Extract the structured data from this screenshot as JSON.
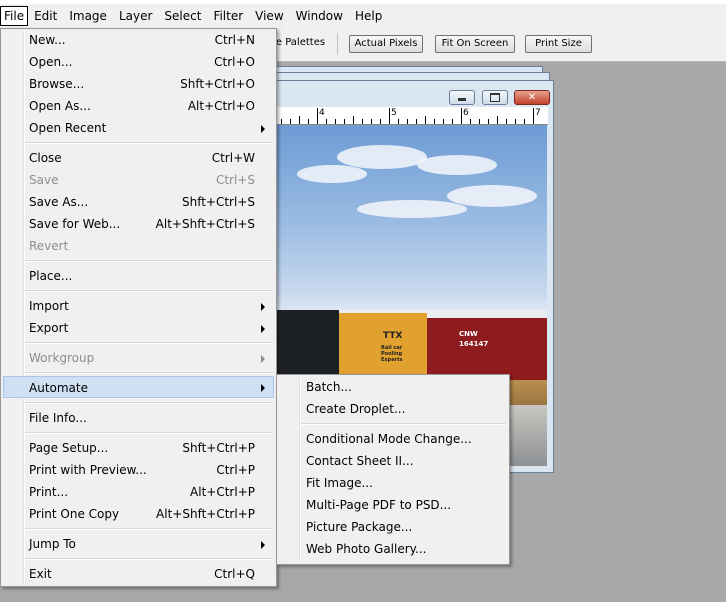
{
  "menubar": {
    "items": [
      "File",
      "Edit",
      "Image",
      "Layer",
      "Select",
      "Filter",
      "View",
      "Window",
      "Help"
    ]
  },
  "options_bar": {
    "partial_label": "re Palettes",
    "buttons": [
      "Actual Pixels",
      "Fit On Screen",
      "Print Size"
    ]
  },
  "document": {
    "ruler_numbers": [
      "4",
      "5",
      "6",
      "7"
    ],
    "car_logo": "TTX",
    "car_text_yellow": "Rail car Pooling Experts",
    "car_text_red_1": "CNW",
    "car_text_red_2": "164147"
  },
  "file_menu": {
    "items": [
      {
        "label": "New...",
        "shortcut": "Ctrl+N"
      },
      {
        "label": "Open...",
        "shortcut": "Ctrl+O"
      },
      {
        "label": "Browse...",
        "shortcut": "Shft+Ctrl+O"
      },
      {
        "label": "Open As...",
        "shortcut": "Alt+Ctrl+O"
      },
      {
        "label": "Open Recent",
        "shortcut": ""
      },
      {
        "label": "Close",
        "shortcut": "Ctrl+W"
      },
      {
        "label": "Save",
        "shortcut": "Ctrl+S"
      },
      {
        "label": "Save As...",
        "shortcut": "Shft+Ctrl+S"
      },
      {
        "label": "Save for Web...",
        "shortcut": "Alt+Shft+Ctrl+S"
      },
      {
        "label": "Revert",
        "shortcut": ""
      },
      {
        "label": "Place...",
        "shortcut": ""
      },
      {
        "label": "Import",
        "shortcut": ""
      },
      {
        "label": "Export",
        "shortcut": ""
      },
      {
        "label": "Workgroup",
        "shortcut": ""
      },
      {
        "label": "Automate",
        "shortcut": ""
      },
      {
        "label": "File Info...",
        "shortcut": ""
      },
      {
        "label": "Page Setup...",
        "shortcut": "Shft+Ctrl+P"
      },
      {
        "label": "Print with Preview...",
        "shortcut": "Ctrl+P"
      },
      {
        "label": "Print...",
        "shortcut": "Alt+Ctrl+P"
      },
      {
        "label": "Print One Copy",
        "shortcut": "Alt+Shft+Ctrl+P"
      },
      {
        "label": "Jump To",
        "shortcut": ""
      },
      {
        "label": "Exit",
        "shortcut": "Ctrl+Q"
      }
    ]
  },
  "automate_menu": {
    "items": [
      "Batch...",
      "Create Droplet...",
      "Conditional Mode Change...",
      "Contact Sheet II...",
      "Fit Image...",
      "Multi-Page PDF to PSD...",
      "Picture Package...",
      "Web Photo Gallery..."
    ]
  }
}
